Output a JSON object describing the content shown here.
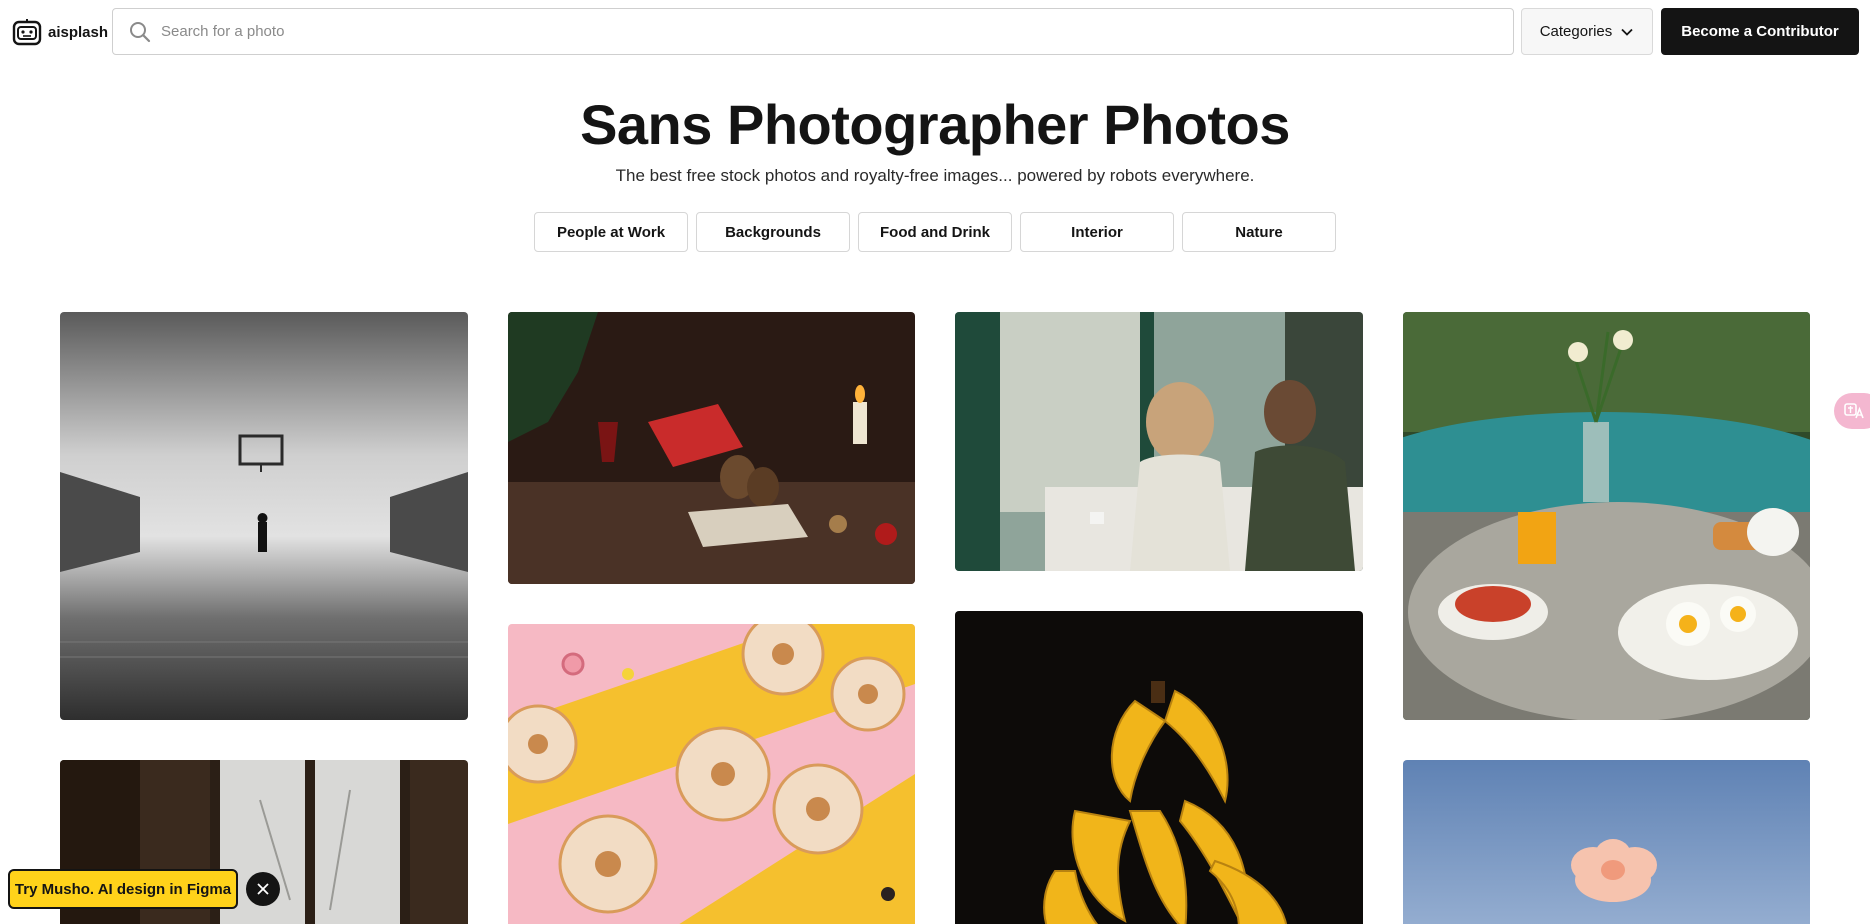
{
  "header": {
    "logo_text": "aisplash",
    "search_placeholder": "Search for a photo",
    "categories_label": "Categories",
    "contributor_label": "Become a Contributor"
  },
  "hero": {
    "title": "Sans Photographer Photos",
    "subtitle": "The best free stock photos and royalty-free images... powered by robots everywhere."
  },
  "chips": [
    {
      "label": "People at Work"
    },
    {
      "label": "Backgrounds"
    },
    {
      "label": "Food and Drink"
    },
    {
      "label": "Interior"
    },
    {
      "label": "Nature"
    }
  ],
  "photos": [
    {
      "name": "basketball-court-photo"
    },
    {
      "name": "christmas-table-photo"
    },
    {
      "name": "cafe-people-photo"
    },
    {
      "name": "poolside-breakfast-photo"
    },
    {
      "name": "donuts-photo"
    },
    {
      "name": "bananas-photo"
    },
    {
      "name": "window-interior-photo"
    },
    {
      "name": "flower-sky-photo"
    }
  ],
  "promo": {
    "label": "Try Musho. AI design in Figma"
  },
  "colors": {
    "brand_dark": "#141414",
    "promo_yellow": "#ffd21a",
    "translate_pink": "#f4b7d0"
  }
}
